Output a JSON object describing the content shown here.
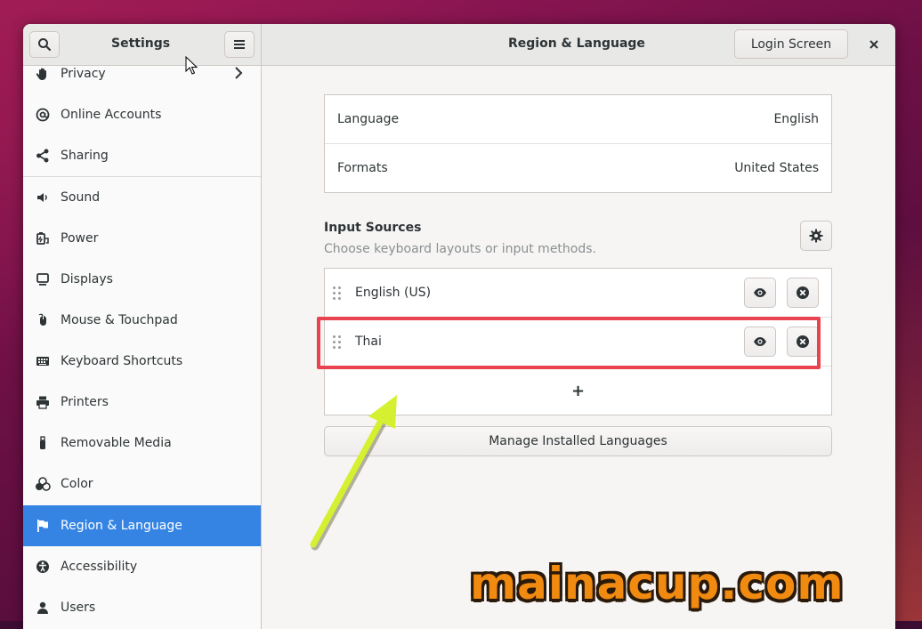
{
  "window": {
    "sidebar_title": "Settings",
    "page_title": "Region & Language",
    "login_screen_label": "Login Screen"
  },
  "sidebar": {
    "items": [
      {
        "label": "Privacy",
        "icon": "hand-icon"
      },
      {
        "label": "Online Accounts",
        "icon": "at-icon"
      },
      {
        "label": "Sharing",
        "icon": "share-icon"
      },
      {
        "label": "Sound",
        "icon": "speaker-icon"
      },
      {
        "label": "Power",
        "icon": "power-icon"
      },
      {
        "label": "Displays",
        "icon": "display-icon"
      },
      {
        "label": "Mouse & Touchpad",
        "icon": "mouse-icon"
      },
      {
        "label": "Keyboard Shortcuts",
        "icon": "keyboard-icon"
      },
      {
        "label": "Printers",
        "icon": "printer-icon"
      },
      {
        "label": "Removable Media",
        "icon": "usb-icon"
      },
      {
        "label": "Color",
        "icon": "color-icon"
      },
      {
        "label": "Region & Language",
        "icon": "flag-icon",
        "active": true
      },
      {
        "label": "Accessibility",
        "icon": "accessibility-icon"
      },
      {
        "label": "Users",
        "icon": "users-icon"
      }
    ]
  },
  "region": {
    "language_label": "Language",
    "language_value": "English",
    "formats_label": "Formats",
    "formats_value": "United States"
  },
  "input_sources": {
    "heading": "Input Sources",
    "subtitle": "Choose keyboard layouts or input methods.",
    "items": [
      {
        "label": "English (US)"
      },
      {
        "label": "Thai"
      }
    ],
    "add_label": "+",
    "manage_label": "Manage Installed Languages"
  },
  "watermark": "mainacup.com",
  "colors": {
    "accent": "#3584e4",
    "highlight": "#e8434f",
    "arrow": "#d4f030",
    "watermark": "#f08a10"
  }
}
